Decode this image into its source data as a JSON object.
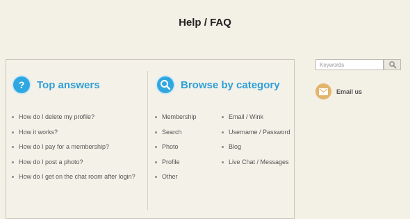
{
  "page": {
    "title": "Help / FAQ"
  },
  "top_answers": {
    "title": "Top answers",
    "items": [
      "How do I delete my profile?",
      "How it works?",
      "How do I pay for a membership?",
      "How do I post a photo?",
      "How do I get on the chat room after login?"
    ]
  },
  "browse": {
    "title": "Browse by category",
    "col1": [
      "Membership",
      "Search",
      "Photo",
      "Profile",
      "Other"
    ],
    "col2": [
      "Email / Wink",
      "Username / Password",
      "Blog",
      "Live Chat / Messages"
    ]
  },
  "search": {
    "placeholder": "Keywords"
  },
  "contact": {
    "email_label": "Email us"
  },
  "colors": {
    "accent_blue": "#2fa7e0",
    "email_gold": "#e3b46b",
    "background": "#f3f0e6"
  }
}
